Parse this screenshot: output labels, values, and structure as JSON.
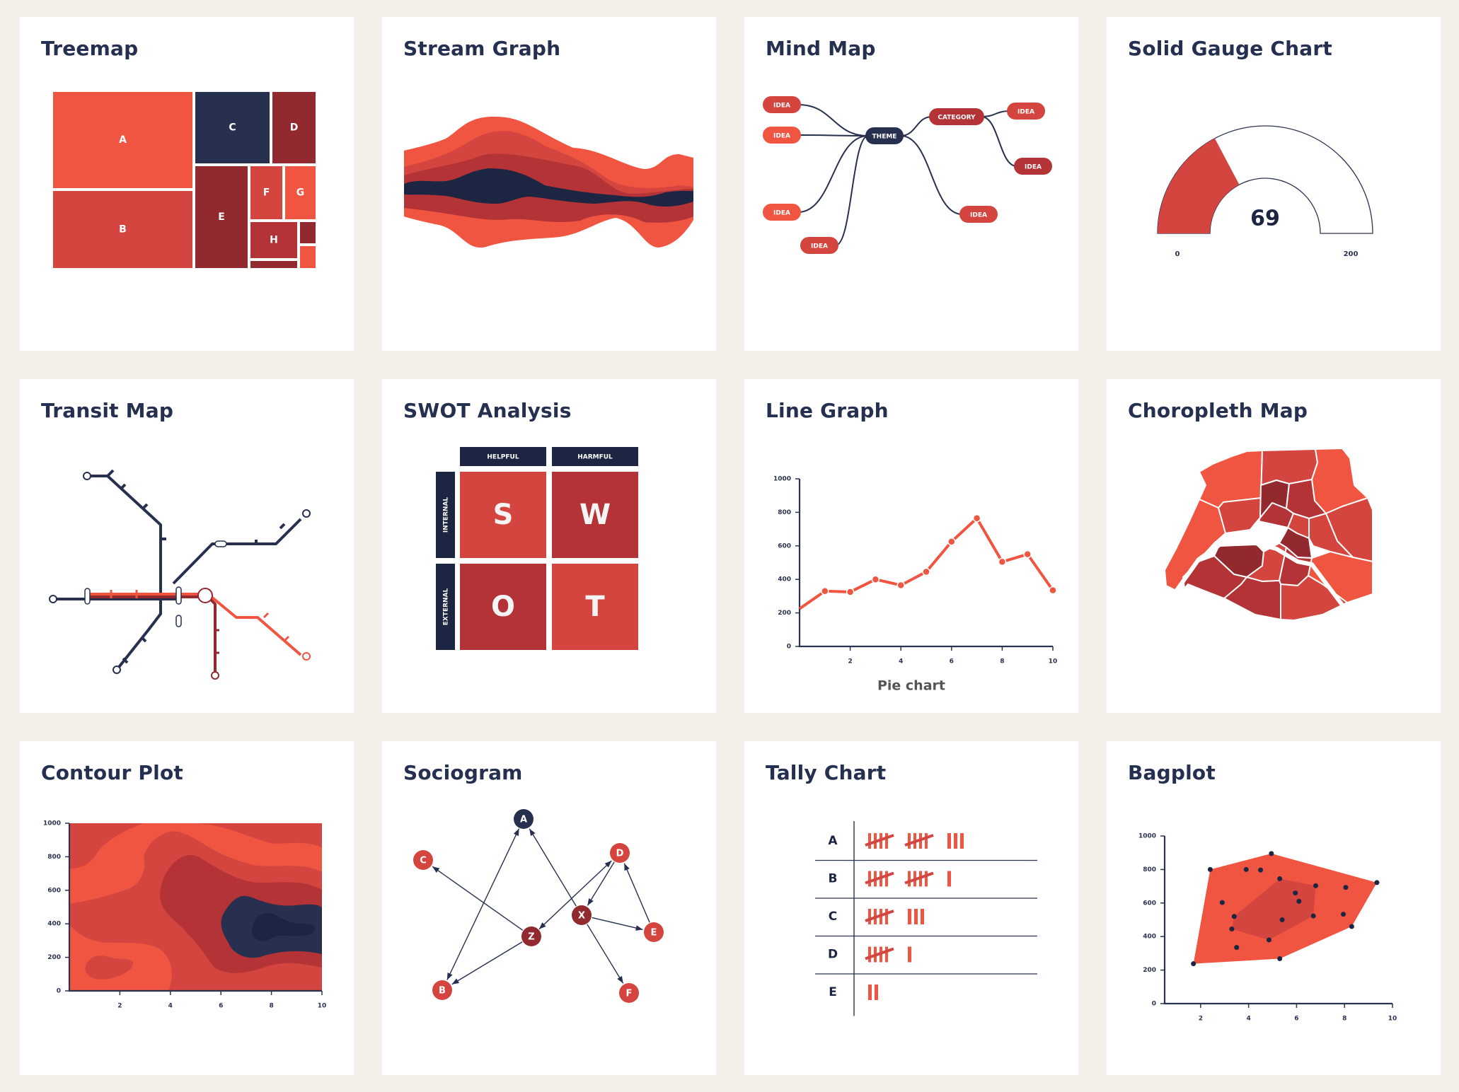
{
  "colors": {
    "coral": "#f05542",
    "red": "#d4453f",
    "crimson": "#b43336",
    "maroon": "#92292e",
    "navy": "#27314f",
    "navy_dark": "#1c2642",
    "axis": "#2a3350",
    "background": "#f4efe9",
    "card": "#ffffff"
  },
  "cards": [
    {
      "id": "treemap",
      "title": "Treemap"
    },
    {
      "id": "stream-graph",
      "title": "Stream Graph"
    },
    {
      "id": "mind-map",
      "title": "Mind Map"
    },
    {
      "id": "solid-gauge",
      "title": "Solid Gauge Chart"
    },
    {
      "id": "transit-map",
      "title": "Transit Map"
    },
    {
      "id": "swot",
      "title": "SWOT Analysis"
    },
    {
      "id": "line-graph",
      "title": "Line Graph"
    },
    {
      "id": "choropleth",
      "title": "Choropleth Map"
    },
    {
      "id": "contour",
      "title": "Contour Plot"
    },
    {
      "id": "sociogram",
      "title": "Sociogram"
    },
    {
      "id": "tally",
      "title": "Tally Chart"
    },
    {
      "id": "bagplot",
      "title": "Bagplot"
    }
  ],
  "chart_data": [
    {
      "id": "treemap",
      "type": "treemap",
      "title": "Treemap",
      "items": [
        {
          "label": "A",
          "share": 0.205,
          "color": "coral"
        },
        {
          "label": "B",
          "share": 0.165,
          "color": "red"
        },
        {
          "label": "C",
          "share": 0.09,
          "color": "navy"
        },
        {
          "label": "D",
          "share": 0.055,
          "color": "maroon"
        },
        {
          "label": "E",
          "share": 0.095,
          "color": "maroon"
        },
        {
          "label": "F",
          "share": 0.04,
          "color": "red"
        },
        {
          "label": "G",
          "share": 0.04,
          "color": "coral"
        },
        {
          "label": "H",
          "share": 0.045,
          "color": "crimson"
        },
        {
          "label": "",
          "share": 0.012,
          "color": "maroon"
        },
        {
          "label": "",
          "share": 0.015,
          "color": "maroon"
        },
        {
          "label": "",
          "share": 0.013,
          "color": "coral"
        }
      ]
    },
    {
      "id": "stream-graph",
      "type": "area",
      "title": "Stream Graph",
      "layers": 7,
      "x": [
        0,
        1,
        2,
        3,
        4,
        5,
        6,
        7,
        8,
        9,
        10
      ],
      "series": [
        {
          "name": "outer-top",
          "color": "coral",
          "values": [
            2,
            3,
            5,
            5,
            4,
            3,
            3,
            2,
            2,
            3,
            2
          ]
        },
        {
          "name": "mid-top",
          "color": "red",
          "values": [
            2,
            3,
            4,
            4,
            3,
            3,
            2,
            2,
            1,
            1,
            1
          ]
        },
        {
          "name": "inner-top",
          "color": "crimson",
          "values": [
            2,
            2,
            2,
            3,
            3,
            3,
            3,
            2,
            2,
            2,
            2
          ]
        },
        {
          "name": "core",
          "color": "navy_dark",
          "values": [
            3,
            3,
            5,
            5,
            4,
            3,
            3,
            3,
            3,
            3,
            3
          ]
        },
        {
          "name": "inner-bottom",
          "color": "crimson",
          "values": [
            3,
            4,
            5,
            4,
            3,
            3,
            3,
            3,
            3,
            3,
            3
          ]
        },
        {
          "name": "mid-bottom",
          "color": "red",
          "values": [
            1,
            2,
            3,
            3,
            3,
            3,
            3,
            2,
            3,
            2,
            2
          ]
        },
        {
          "name": "outer-bottom",
          "color": "coral",
          "values": [
            1,
            2,
            2,
            2,
            3,
            3,
            3,
            3,
            2,
            3,
            3
          ]
        }
      ]
    },
    {
      "id": "mind-map",
      "type": "diagram",
      "title": "Mind Map",
      "nodes": [
        {
          "id": "theme",
          "label": "THEME",
          "color": "navy"
        },
        {
          "id": "i1",
          "label": "IDEA",
          "color": "red"
        },
        {
          "id": "i2",
          "label": "IDEA",
          "color": "coral"
        },
        {
          "id": "i3",
          "label": "IDEA",
          "color": "coral"
        },
        {
          "id": "i4",
          "label": "IDEA",
          "color": "red"
        },
        {
          "id": "cat",
          "label": "CATEGORY",
          "color": "crimson"
        },
        {
          "id": "i5",
          "label": "IDEA",
          "color": "red"
        },
        {
          "id": "i6",
          "label": "IDEA",
          "color": "crimson"
        },
        {
          "id": "i7",
          "label": "IDEA",
          "color": "red"
        }
      ],
      "edges": [
        [
          "theme",
          "i1"
        ],
        [
          "theme",
          "i2"
        ],
        [
          "theme",
          "i3"
        ],
        [
          "theme",
          "i4"
        ],
        [
          "theme",
          "cat"
        ],
        [
          "theme",
          "i7"
        ],
        [
          "cat",
          "i5"
        ],
        [
          "cat",
          "i6"
        ]
      ]
    },
    {
      "id": "solid-gauge",
      "type": "gauge",
      "title": "Solid Gauge Chart",
      "value": 69,
      "value_label": "69",
      "min": 0,
      "max": 200,
      "min_label": "0",
      "max_label": "200",
      "fill_fraction": 0.345
    },
    {
      "id": "transit-map",
      "type": "diagram",
      "title": "Transit Map",
      "lines": [
        {
          "name": "navy-line",
          "color": "navy"
        },
        {
          "name": "coral-line",
          "color": "coral"
        },
        {
          "name": "maroon-line",
          "color": "maroon"
        }
      ]
    },
    {
      "id": "swot",
      "type": "table",
      "title": "SWOT Analysis",
      "columns": [
        "HELPFUL",
        "HARMFUL"
      ],
      "rows": [
        "INTERNAL",
        "EXTERNAL"
      ],
      "cells": [
        [
          {
            "letter": "S",
            "color": "red"
          },
          {
            "letter": "W",
            "color": "crimson"
          }
        ],
        [
          {
            "letter": "O",
            "color": "crimson"
          },
          {
            "letter": "T",
            "color": "red"
          }
        ]
      ]
    },
    {
      "id": "line-graph",
      "type": "line",
      "title": "Line Graph",
      "xlabel": "Pie chart",
      "ylabel": "",
      "x": [
        0,
        1,
        2,
        3,
        4,
        5,
        6,
        7,
        8,
        9,
        10
      ],
      "values": [
        225,
        330,
        325,
        400,
        365,
        445,
        625,
        765,
        505,
        550,
        335
      ],
      "xlim": [
        0,
        10
      ],
      "ylim": [
        0,
        1000
      ],
      "xticks": [
        "2",
        "4",
        "6",
        "8",
        "10"
      ],
      "yticks": [
        "0",
        "200",
        "400",
        "600",
        "800",
        "1000"
      ],
      "grid": false
    },
    {
      "id": "choropleth",
      "type": "map",
      "title": "Choropleth Map",
      "region": "Paris arrondissements",
      "levels": [
        "coral",
        "red",
        "crimson",
        "maroon"
      ]
    },
    {
      "id": "contour",
      "type": "heatmap",
      "title": "Contour Plot",
      "xlim": [
        0,
        10
      ],
      "ylim": [
        0,
        1000
      ],
      "xticks": [
        "2",
        "4",
        "6",
        "8",
        "10"
      ],
      "yticks": [
        "0",
        "200",
        "400",
        "600",
        "800",
        "1000"
      ],
      "peak": {
        "x": 7.5,
        "y": 380
      },
      "levels": [
        "coral",
        "red",
        "crimson",
        "navy",
        "navy_dark"
      ]
    },
    {
      "id": "sociogram",
      "type": "diagram",
      "title": "Sociogram",
      "nodes": [
        {
          "id": "A",
          "label": "A",
          "color": "navy"
        },
        {
          "id": "B",
          "label": "B",
          "color": "red"
        },
        {
          "id": "C",
          "label": "C",
          "color": "red"
        },
        {
          "id": "D",
          "label": "D",
          "color": "red"
        },
        {
          "id": "E",
          "label": "E",
          "color": "red"
        },
        {
          "id": "F",
          "label": "F",
          "color": "red"
        },
        {
          "id": "X",
          "label": "X",
          "color": "maroon"
        },
        {
          "id": "Z",
          "label": "Z",
          "color": "maroon"
        }
      ],
      "edges": [
        {
          "from": "A",
          "to": "B",
          "both": true
        },
        {
          "from": "Z",
          "to": "C",
          "both": false
        },
        {
          "from": "Z",
          "to": "B",
          "both": false
        },
        {
          "from": "X",
          "to": "A",
          "both": false
        },
        {
          "from": "Z",
          "to": "D",
          "both": true
        },
        {
          "from": "D",
          "to": "X",
          "both": false
        },
        {
          "from": "X",
          "to": "E",
          "both": false
        },
        {
          "from": "E",
          "to": "D",
          "both": false
        },
        {
          "from": "X",
          "to": "F",
          "both": false
        }
      ]
    },
    {
      "id": "tally",
      "type": "table",
      "title": "Tally Chart",
      "categories": [
        "A",
        "B",
        "C",
        "D",
        "E"
      ],
      "values": [
        13,
        11,
        8,
        6,
        2
      ]
    },
    {
      "id": "bagplot",
      "type": "scatter",
      "title": "Bagplot",
      "xlim": [
        0.5,
        10
      ],
      "ylim": [
        0,
        1000
      ],
      "xticks": [
        "2",
        "4",
        "6",
        "8",
        "10"
      ],
      "yticks": [
        "0",
        "200",
        "400",
        "600",
        "800",
        "1000"
      ],
      "points": [
        [
          1.7,
          238
        ],
        [
          2.4,
          800
        ],
        [
          2.9,
          603
        ],
        [
          3.3,
          445
        ],
        [
          3.4,
          520
        ],
        [
          3.5,
          335
        ],
        [
          3.9,
          800
        ],
        [
          4.5,
          797
        ],
        [
          4.85,
          380
        ],
        [
          4.95,
          895
        ],
        [
          5.3,
          745
        ],
        [
          5.3,
          268
        ],
        [
          5.4,
          500
        ],
        [
          5.95,
          660
        ],
        [
          6.1,
          610
        ],
        [
          6.7,
          523
        ],
        [
          6.8,
          703
        ],
        [
          7.95,
          533
        ],
        [
          8.05,
          693
        ],
        [
          8.3,
          460
        ],
        [
          9.35,
          722
        ]
      ],
      "hull": [
        [
          1.7,
          238
        ],
        [
          2.4,
          800
        ],
        [
          4.95,
          895
        ],
        [
          9.35,
          722
        ],
        [
          8.3,
          460
        ],
        [
          5.3,
          268
        ]
      ],
      "bag": [
        [
          3.3,
          445
        ],
        [
          3.4,
          520
        ],
        [
          5.3,
          745
        ],
        [
          6.8,
          703
        ],
        [
          6.7,
          523
        ],
        [
          4.85,
          380
        ]
      ]
    }
  ]
}
